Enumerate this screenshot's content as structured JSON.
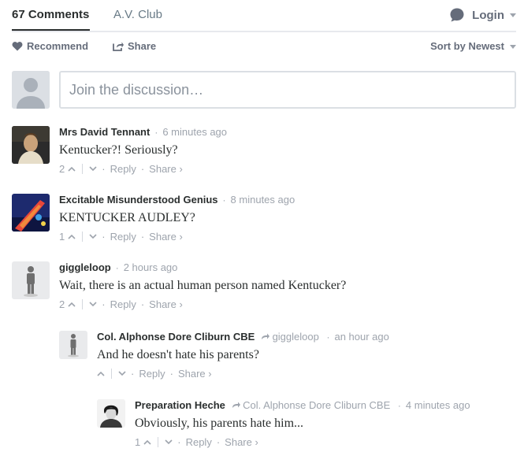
{
  "tabs": {
    "comments_label": "67 Comments",
    "site_label": "A.V. Club",
    "login_label": "Login"
  },
  "actions": {
    "recommend_label": "Recommend",
    "share_label": "Share",
    "sort_label": "Sort by Newest"
  },
  "composer": {
    "placeholder": "Join the discussion…"
  },
  "comments": [
    {
      "author": "Mrs David Tennant",
      "time": "6 minutes ago",
      "text": "Kentucker?! Seriously?",
      "votes": "2",
      "reply_label": "Reply",
      "share_label": "Share ›"
    },
    {
      "author": "Excitable Misunderstood Genius",
      "time": "8 minutes ago",
      "text": "KENTUCKER AUDLEY?",
      "votes": "1",
      "reply_label": "Reply",
      "share_label": "Share ›"
    },
    {
      "author": "giggleloop",
      "time": "2 hours ago",
      "text": "Wait, there is an actual human person named Kentucker?",
      "votes": "2",
      "reply_label": "Reply",
      "share_label": "Share ›"
    },
    {
      "author": "Col. Alphonse Dore Cliburn CBE",
      "reply_to": "giggleloop",
      "time": "an hour ago",
      "text": "And he doesn't hate his parents?",
      "votes": "",
      "reply_label": "Reply",
      "share_label": "Share ›"
    },
    {
      "author": "Preparation Heche",
      "reply_to": "Col. Alphonse Dore Cliburn CBE",
      "time": "4 minutes ago",
      "text": "Obviously, his parents hate him...",
      "votes": "1",
      "reply_label": "Reply",
      "share_label": "Share ›"
    }
  ],
  "icons": {
    "login": "speech-bubble-icon",
    "recommend": "heart-icon",
    "share": "share-icon",
    "vote_up": "chevron-up-icon",
    "vote_down": "chevron-down-icon",
    "reply_arrow": "reply-arrow-icon"
  },
  "colors": {
    "text": "#2a2e2e",
    "muted": "#9ea4ad",
    "action": "#656c7a",
    "border": "#dbdfe4"
  }
}
